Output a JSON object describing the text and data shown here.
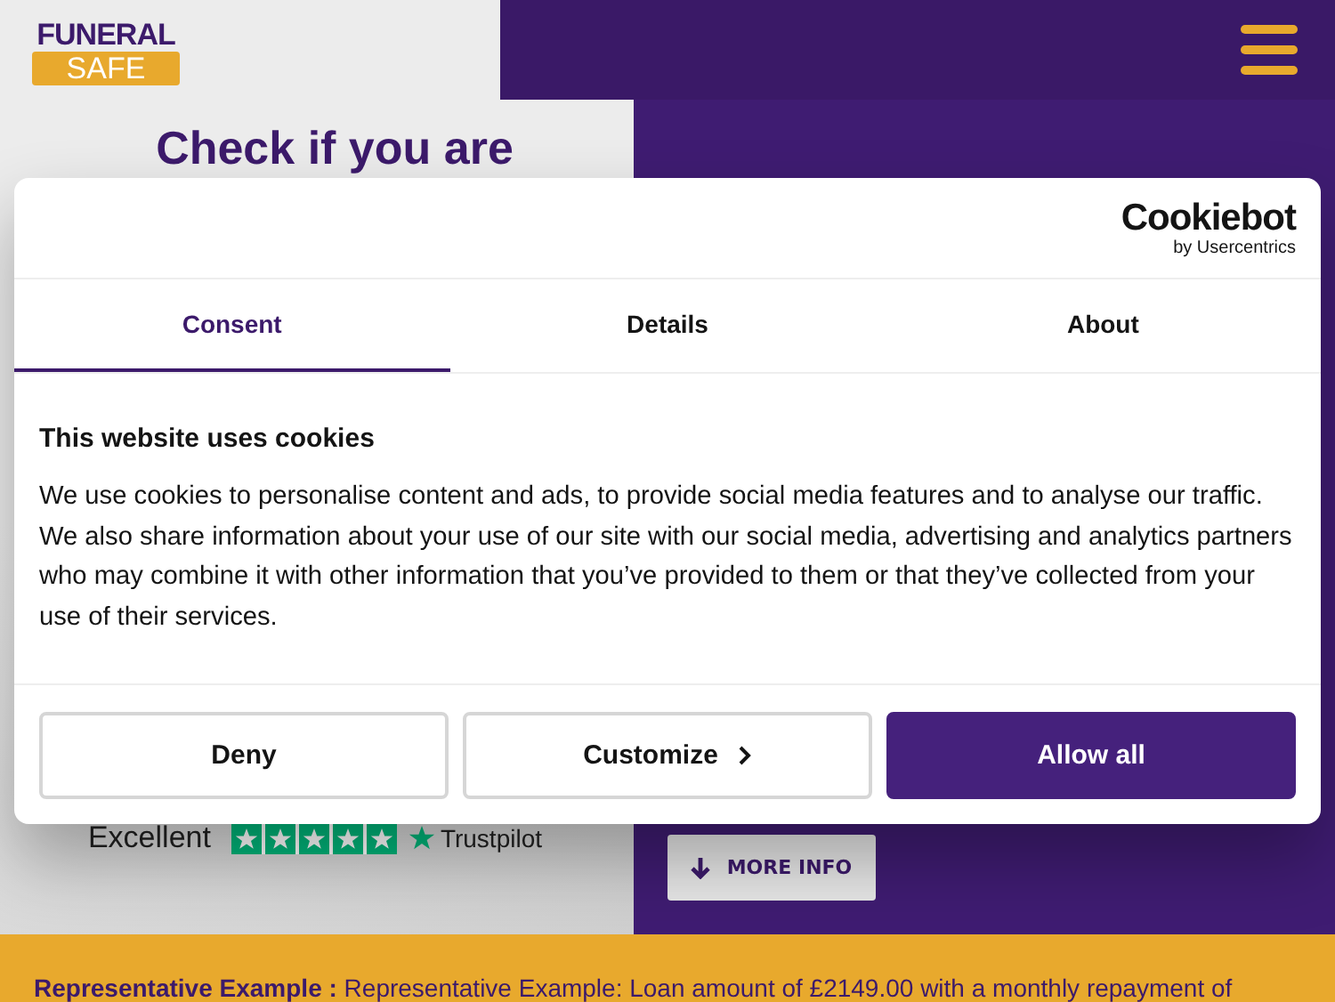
{
  "logo": {
    "top": "FUNERAL",
    "bottom": "SAFE"
  },
  "hero": {
    "left_heading": "Check if you are",
    "rating": {
      "label": "Excellent",
      "stars": 5,
      "brand": "Trustpilot"
    },
    "more_info": "MORE INFO"
  },
  "banner": {
    "text": "**Representative Example :** Representative Example: Loan amount of £2149.00 with a monthly repayment of"
  },
  "cookie_dialog": {
    "brand": "Cookiebot",
    "brand_sub": "by Usercentrics",
    "tabs": [
      {
        "label": "Consent",
        "selected": true
      },
      {
        "label": "Details",
        "selected": false
      },
      {
        "label": "About",
        "selected": false
      }
    ],
    "title": "This website uses cookies",
    "body": "We use cookies to personalise content and ads, to provide social media features and to analyse our traffic. We also share information about your use of our site with our social media, advertising and analytics partners who may combine it with other information that you’ve provided to them or that they’ve collected from your use of their services.",
    "buttons": [
      {
        "label": "Deny",
        "kind": "outline"
      },
      {
        "label": "Customize",
        "kind": "chevron"
      },
      {
        "label": "Allow all",
        "kind": "primary"
      }
    ]
  }
}
